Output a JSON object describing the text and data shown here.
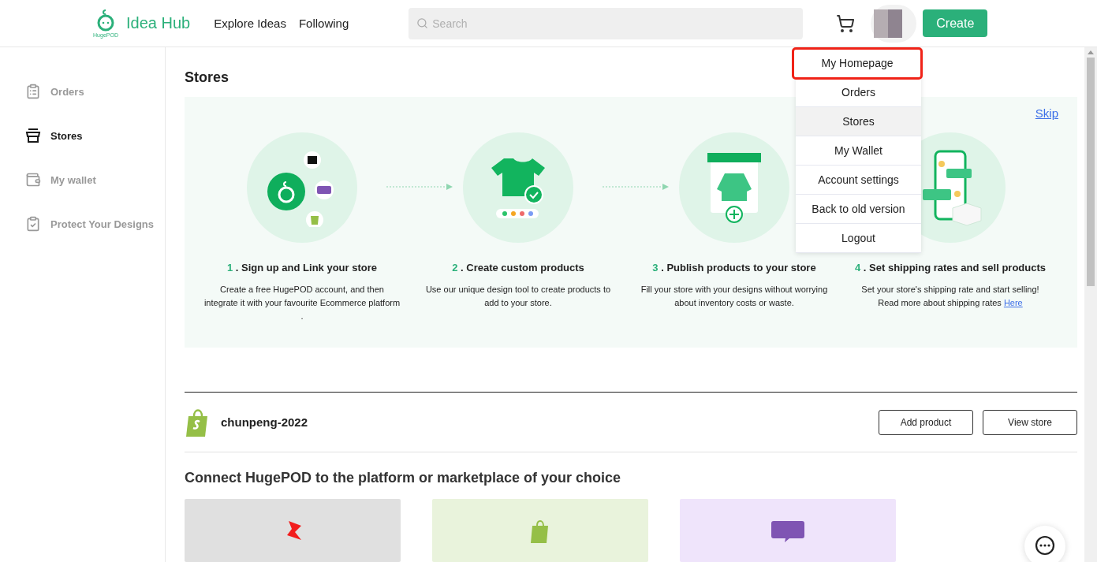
{
  "header": {
    "logo_caption": "HugePOD",
    "brand": "Idea Hub",
    "nav": [
      {
        "label": "Explore Ideas"
      },
      {
        "label": "Following"
      }
    ],
    "search": {
      "placeholder": "Search"
    },
    "create_button": "Create"
  },
  "user_menu": {
    "open": true,
    "items": [
      {
        "label": "My Homepage",
        "highlighted": true,
        "hovered": false
      },
      {
        "label": "Orders",
        "highlighted": false,
        "hovered": false
      },
      {
        "label": "Stores",
        "highlighted": false,
        "hovered": true
      },
      {
        "label": "My Wallet",
        "highlighted": false,
        "hovered": false
      },
      {
        "label": "Account settings",
        "highlighted": false,
        "hovered": false
      },
      {
        "label": "Back to old version",
        "highlighted": false,
        "hovered": false
      },
      {
        "label": "Logout",
        "highlighted": false,
        "hovered": false
      }
    ]
  },
  "sidebar": {
    "items": [
      {
        "label": "Orders",
        "kind": "orders",
        "selected": false
      },
      {
        "label": "Stores",
        "kind": "stores",
        "selected": true
      },
      {
        "label": "My wallet",
        "kind": "wallet",
        "selected": false
      },
      {
        "label": "Protect Your Designs",
        "kind": "protect",
        "selected": false
      }
    ]
  },
  "page_title": "Stores",
  "guide": {
    "skip": "Skip",
    "steps": [
      {
        "kind": "link",
        "arrow_after": true,
        "number": "1",
        "title": ". Sign up and Link your store",
        "text": "Create a free HugePOD account, and then integrate it with your favourite Ecommerce platform ."
      },
      {
        "kind": "design",
        "arrow_after": true,
        "number": "2",
        "title": ". Create custom products",
        "text": "Use our unique design tool to create products to add to your store."
      },
      {
        "kind": "publish",
        "number": "3",
        "title": ". Publish products to your store",
        "text": "Fill your store with your designs without worrying about inventory costs or waste."
      },
      {
        "kind": "ship",
        "number": "4",
        "title": ". Set shipping rates and sell products",
        "text": "Set your store's shipping rate and start selling! Read more about shipping rates",
        "link": "Here"
      }
    ]
  },
  "store": {
    "name": "chunpeng-2022",
    "buttons": [
      "Add product",
      "View store"
    ]
  },
  "connect": {
    "heading": "Connect HugePOD to the platform or marketplace of your choice",
    "platforms": [
      {
        "kind": "red",
        "color": "#e0e0e0"
      },
      {
        "kind": "shopify",
        "color": "#e9f3dc"
      },
      {
        "kind": "woo",
        "color": "#efe4fb"
      }
    ]
  }
}
